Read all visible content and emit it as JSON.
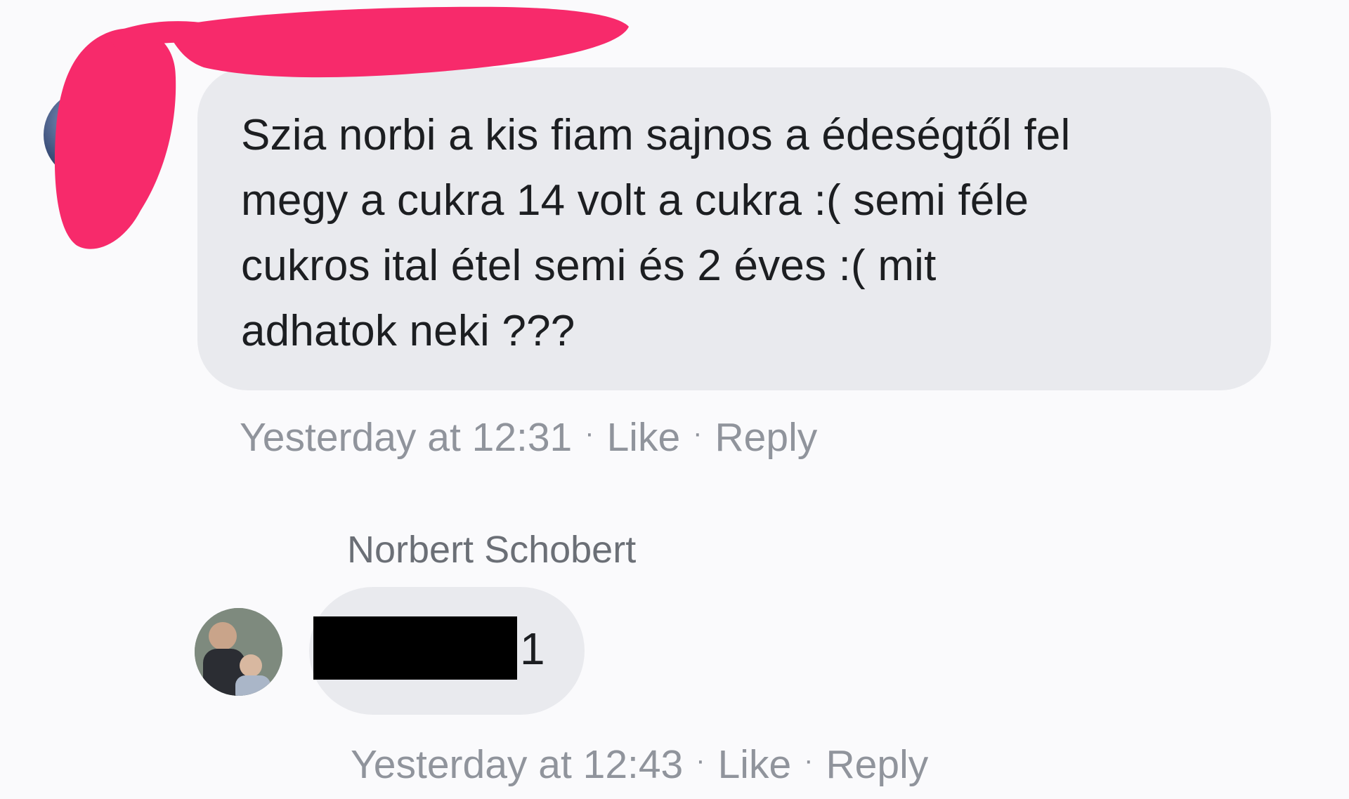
{
  "comment": {
    "text": "Szia norbi a kis fiam sajnos a édeségtől fel\nmegy a cukra 14 volt a cukra :( semi féle\ncukros ital étel semi és 2 éves :( mit\nadhatok neki ???",
    "timestamp": "Yesterday at 12:31",
    "like_label": "Like",
    "reply_label": "Reply",
    "separator": "·"
  },
  "reply": {
    "author": "Norbert Schobert",
    "visible_text": "1",
    "timestamp": "Yesterday at 12:43",
    "like_label": "Like",
    "reply_label": "Reply",
    "separator": "·"
  },
  "colors": {
    "background": "#fafafc",
    "bubble": "#e9eaee",
    "meta_text": "#90949c",
    "redaction_scribble": "#f72a6b",
    "redaction_box": "#000000"
  }
}
